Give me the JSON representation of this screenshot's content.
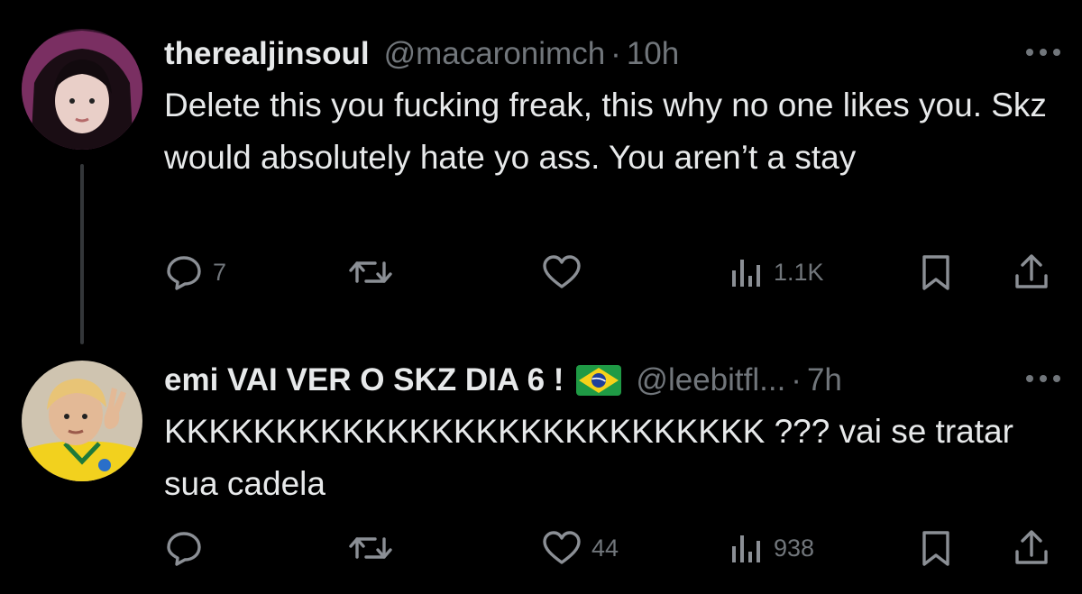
{
  "colors": {
    "background": "#000000",
    "text": "#e7e9ea",
    "muted": "#71767b",
    "thread_line": "#333639"
  },
  "tweets": [
    {
      "display_name": "therealjinsoul",
      "handle": "@macaronimch",
      "separator": "·",
      "time": "10h",
      "text": "Delete this you fucking freak, this why no one likes you. Skz would absolutely hate yo ass. You aren’t a stay",
      "reply_count": "7",
      "repost_count": "",
      "like_count": "",
      "view_count": "1.1K",
      "avatar_icon": "profile-photo-girl-purple-hood"
    },
    {
      "display_name": "emi VAI VER O SKZ DIA 6 !",
      "handle": "@leebitfl...",
      "separator": "·",
      "time": "7h",
      "text": "KKKKKKKKKKKKKKKKKKKKKKKKKKK ??? vai se tratar sua cadela",
      "reply_count": "",
      "repost_count": "",
      "like_count": "44",
      "view_count": "938",
      "avatar_icon": "profile-photo-boy-brazil-jersey",
      "name_emoji": "brazil-flag-icon"
    }
  ]
}
